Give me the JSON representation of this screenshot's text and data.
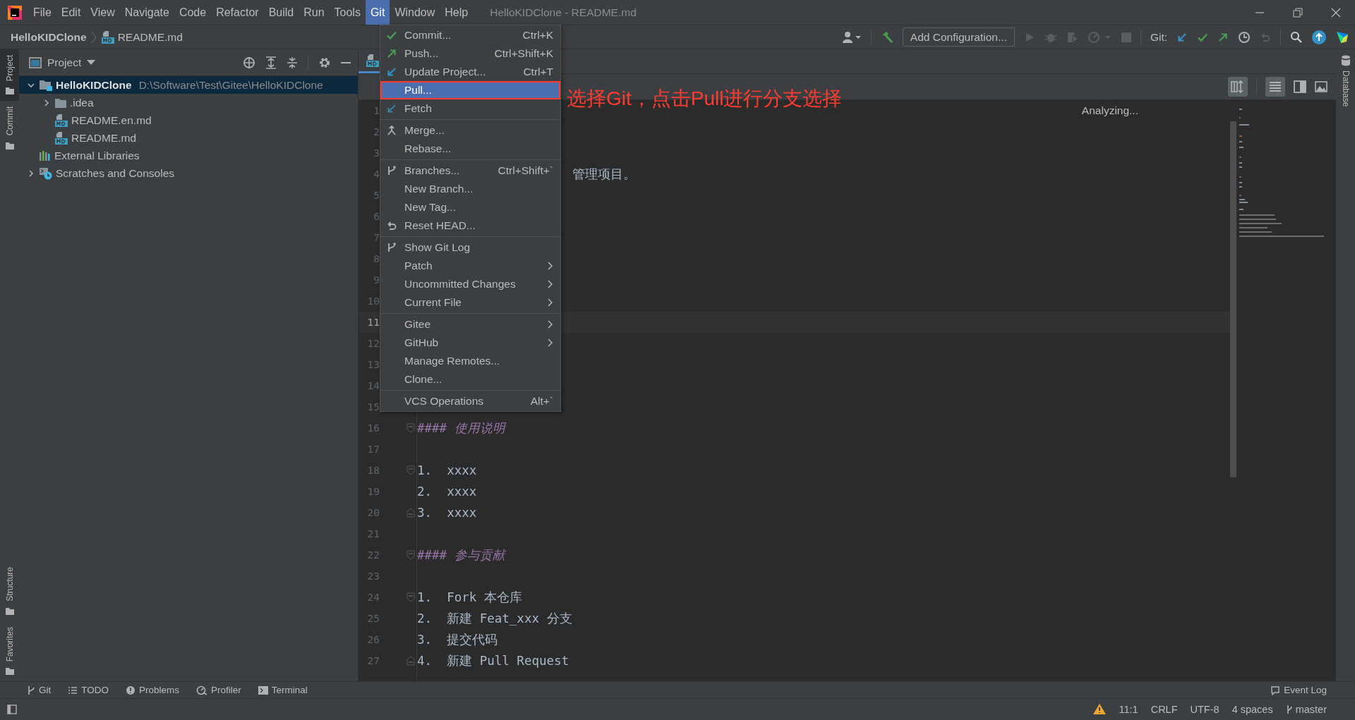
{
  "menubar": {
    "items": [
      {
        "label": "File",
        "selected": false
      },
      {
        "label": "Edit",
        "selected": false
      },
      {
        "label": "View",
        "selected": false
      },
      {
        "label": "Navigate",
        "selected": false
      },
      {
        "label": "Code",
        "selected": false
      },
      {
        "label": "Refactor",
        "selected": false
      },
      {
        "label": "Build",
        "selected": false
      },
      {
        "label": "Run",
        "selected": false
      },
      {
        "label": "Tools",
        "selected": false
      },
      {
        "label": "Git",
        "selected": true
      },
      {
        "label": "Window",
        "selected": false
      },
      {
        "label": "Help",
        "selected": false
      }
    ],
    "title": "HelloKIDClone - README.md"
  },
  "navbar": {
    "breadcrumbs": [
      "HelloKIDClone",
      "README.md"
    ],
    "run_config": "Add Configuration...",
    "vcs_label": "Git:"
  },
  "tool_strip": {
    "left": [
      {
        "label": "Project",
        "selected": true,
        "bottom": false
      },
      {
        "label": "Commit",
        "selected": false,
        "bottom": false
      },
      {
        "label": "Structure",
        "selected": false,
        "bottom": true
      },
      {
        "label": "Favorites",
        "selected": false,
        "bottom": true
      }
    ],
    "right": [
      {
        "label": "Database",
        "selected": false,
        "bottom": false
      }
    ]
  },
  "project": {
    "title": "Project",
    "tree": [
      {
        "name": "HelloKIDClone",
        "path": "D:\\Software\\Test\\Gitee\\HelloKIDClone",
        "kind": "module",
        "expanded": true,
        "selected": true,
        "children": [
          {
            "name": ".idea",
            "kind": "folder",
            "expanded": false,
            "selected": false
          },
          {
            "name": "README.en.md",
            "kind": "markdown",
            "selected": false
          },
          {
            "name": "README.md",
            "kind": "markdown",
            "selected": false
          }
        ]
      },
      {
        "name": "External Libraries",
        "kind": "libraries",
        "selected": false
      },
      {
        "name": "Scratches and Consoles",
        "kind": "scratches",
        "expanded": false,
        "selected": false
      }
    ]
  },
  "editor": {
    "status": "Analyzing...",
    "lines": [
      {
        "number": "1",
        "current": false
      },
      {
        "number": "2",
        "current": false
      },
      {
        "number": "3",
        "current": false
      },
      {
        "number": "4",
        "current": false,
        "text": "管理项目。",
        "kind": "plain",
        "behind_menu": true
      },
      {
        "number": "5",
        "current": false
      },
      {
        "number": "6",
        "current": false
      },
      {
        "number": "7",
        "current": false
      },
      {
        "number": "8",
        "current": false
      },
      {
        "number": "9",
        "current": false
      },
      {
        "number": "10",
        "current": false
      },
      {
        "number": "11",
        "current": true
      },
      {
        "number": "12",
        "current": false
      },
      {
        "number": "13",
        "current": false
      },
      {
        "number": "14",
        "current": false
      },
      {
        "number": "15",
        "current": false
      },
      {
        "number": "16",
        "current": false,
        "text": "#### 使用说明",
        "kind": "heading",
        "fold_start": true
      },
      {
        "number": "17",
        "current": false
      },
      {
        "number": "18",
        "current": false,
        "text": "1.  xxxx",
        "kind": "plain",
        "fold_start": true
      },
      {
        "number": "19",
        "current": false,
        "text": "2.  xxxx",
        "kind": "plain"
      },
      {
        "number": "20",
        "current": false,
        "text": "3.  xxxx",
        "kind": "plain",
        "fold_end": true
      },
      {
        "number": "21",
        "current": false
      },
      {
        "number": "22",
        "current": false,
        "text": "#### 参与贡献",
        "kind": "heading",
        "fold_start": true
      },
      {
        "number": "23",
        "current": false
      },
      {
        "number": "24",
        "current": false,
        "text": "1.  Fork 本仓库",
        "kind": "plain",
        "fold_start": true
      },
      {
        "number": "25",
        "current": false,
        "text": "2.  新建 Feat_xxx 分支",
        "kind": "plain"
      },
      {
        "number": "26",
        "current": false,
        "text": "3.  提交代码",
        "kind": "plain"
      },
      {
        "number": "27",
        "current": false,
        "text": "4.  新建 Pull Request",
        "kind": "plain",
        "fold_end": true
      }
    ]
  },
  "git_menu": {
    "groups": [
      [
        {
          "label": "Commit...",
          "shortcut": "Ctrl+K",
          "submenu": false,
          "selected": false,
          "boxed": false
        },
        {
          "label": "Push...",
          "shortcut": "Ctrl+Shift+K",
          "submenu": false,
          "selected": false,
          "boxed": false
        },
        {
          "label": "Update Project...",
          "shortcut": "Ctrl+T",
          "submenu": false,
          "selected": false,
          "boxed": false
        },
        {
          "label": "Pull...",
          "submenu": false,
          "selected": true,
          "boxed": true
        },
        {
          "label": "Fetch",
          "submenu": false,
          "selected": false,
          "boxed": false
        }
      ],
      [
        {
          "label": "Merge...",
          "submenu": false,
          "selected": false,
          "boxed": false
        },
        {
          "label": "Rebase...",
          "submenu": false,
          "selected": false,
          "boxed": false
        }
      ],
      [
        {
          "label": "Branches...",
          "shortcut": "Ctrl+Shift+`",
          "submenu": false,
          "selected": false,
          "boxed": false
        },
        {
          "label": "New Branch...",
          "submenu": false,
          "selected": false,
          "boxed": false
        },
        {
          "label": "New Tag...",
          "submenu": false,
          "selected": false,
          "boxed": false
        },
        {
          "label": "Reset HEAD...",
          "submenu": false,
          "selected": false,
          "boxed": false
        }
      ],
      [
        {
          "label": "Show Git Log",
          "submenu": false,
          "selected": false,
          "boxed": false
        },
        {
          "label": "Patch",
          "submenu": true,
          "selected": false,
          "boxed": false
        },
        {
          "label": "Uncommitted Changes",
          "submenu": true,
          "selected": false,
          "boxed": false
        },
        {
          "label": "Current File",
          "submenu": true,
          "selected": false,
          "boxed": false
        }
      ],
      [
        {
          "label": "Gitee",
          "submenu": true,
          "selected": false,
          "boxed": false
        },
        {
          "label": "GitHub",
          "submenu": true,
          "selected": false,
          "boxed": false
        },
        {
          "label": "Manage Remotes...",
          "submenu": false,
          "selected": false,
          "boxed": false
        },
        {
          "label": "Clone...",
          "submenu": false,
          "selected": false,
          "boxed": false
        }
      ],
      [
        {
          "label": "VCS Operations",
          "shortcut": "Alt+`",
          "submenu": false,
          "selected": false,
          "boxed": false
        }
      ]
    ]
  },
  "callout": "选择Git，点击Pull进行分支选择",
  "bottom_tools": [
    "Git",
    "TODO",
    "Problems",
    "Profiler",
    "Terminal"
  ],
  "event_log": "Event Log",
  "status_bar": {
    "position": "11:1",
    "line_ending": "CRLF",
    "encoding": "UTF-8",
    "indent": "4 spaces",
    "branch": "master"
  }
}
